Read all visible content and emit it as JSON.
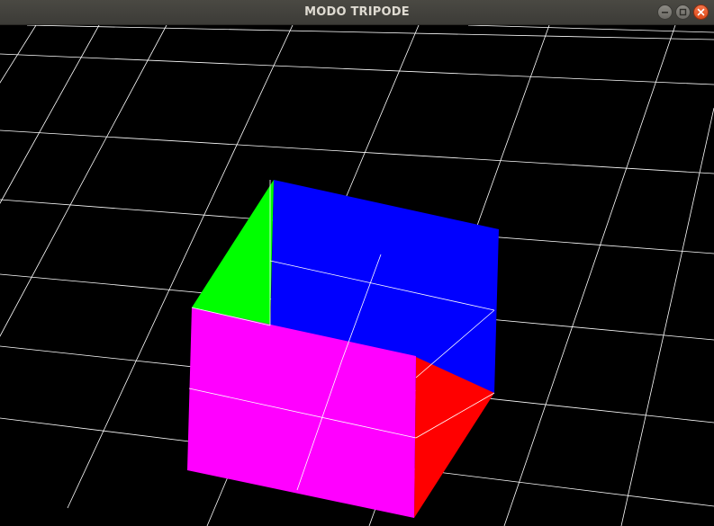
{
  "window": {
    "title": "MODO TRIPODE"
  },
  "controls": {
    "minimize_icon": "minimize-icon",
    "maximize_icon": "maximize-icon",
    "close_icon": "close-icon"
  },
  "scene": {
    "background_color": "#000000",
    "grid_color": "#ffffff",
    "cube_faces": {
      "top": "#0000ff",
      "left": "#00ff00",
      "front": "#ff00ff",
      "right": "#ff0000"
    }
  }
}
